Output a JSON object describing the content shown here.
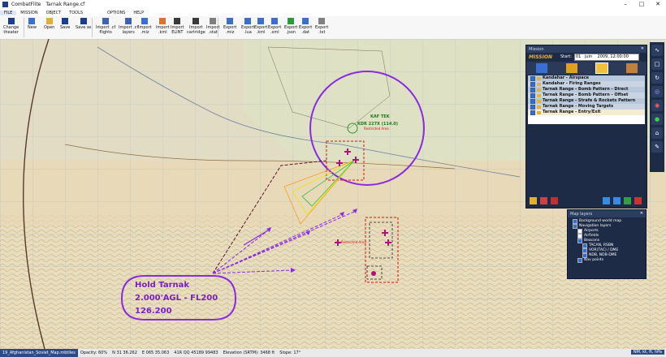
{
  "window": {
    "app": "CombatFlite",
    "doc": "Tarnak Range.cf"
  },
  "menu": [
    "FILE",
    "MISSION",
    "OBJECT",
    "TOOLS",
    "OPTIONS",
    "HELP"
  ],
  "ribbon": [
    {
      "label": "Change\ntheater",
      "icon": "globe-icon"
    },
    {
      "label": "New",
      "icon": "new-file-icon"
    },
    {
      "label": "Open",
      "icon": "folder-icon"
    },
    {
      "label": "Save",
      "icon": "save-icon"
    },
    {
      "label": "Save as",
      "icon": "save-as-icon"
    },
    {
      "label": "Import .cf\nflights",
      "icon": "import-flights-icon"
    },
    {
      "label": "Import .cf\nlayers",
      "icon": "import-layers-icon"
    },
    {
      "label": "Import\n.miz",
      "icon": "import-miz-icon"
    },
    {
      "label": "Import\n.kml",
      "icon": "import-kml-icon"
    },
    {
      "label": "Import\nELINT",
      "icon": "import-elint-icon"
    },
    {
      "label": "Import\ncartridge",
      "icon": "import-cartridge-icon"
    },
    {
      "label": "Import\n.stat",
      "icon": "import-stat-icon"
    },
    {
      "label": "Export\n.miz",
      "icon": "export-miz-icon"
    },
    {
      "label": "Export\n.lua",
      "icon": "export-lua-icon"
    },
    {
      "label": "Export\n.kml",
      "icon": "export-kml-icon"
    },
    {
      "label": "Export\n.xml",
      "icon": "export-xml-icon"
    },
    {
      "label": "Export\n.json",
      "icon": "export-json-icon"
    },
    {
      "label": "Export\n.dat",
      "icon": "export-dat-icon"
    },
    {
      "label": "Export\n.txt",
      "icon": "export-txt-icon"
    }
  ],
  "mission": {
    "title": "Mission",
    "label": "MISSION",
    "start_label": "Start:",
    "start_value": "01   juin    2009, 12:00:00",
    "items": [
      "Kandahar - Airspace",
      "Kandahar - Firing Ranges",
      "Tarnak Range - Bomb Pattern - Direct",
      "Tarnak Range - Bomb Pattern - Offset",
      "Tarnak Range - Strafe & Rockets Pattern",
      "Tarnak Range - Moving Targets",
      "Tarnak Range - Entry/Exit"
    ]
  },
  "layers": {
    "title": "Map layers",
    "items": [
      {
        "t": "Background world map",
        "lv": 0
      },
      {
        "t": "Navigation layers",
        "lv": 0
      },
      {
        "t": "Airports",
        "lv": 1
      },
      {
        "t": "Airfields",
        "lv": 1
      },
      {
        "t": "Beacons",
        "lv": 1
      },
      {
        "t": "TACAN, RSBN",
        "lv": 2
      },
      {
        "t": "VOR(TAC) / DME",
        "lv": 2
      },
      {
        "t": "NDB, NDB-DME",
        "lv": 2
      },
      {
        "t": "Nav points",
        "lv": 1
      }
    ]
  },
  "map": {
    "hold_lines": [
      "Hold Tarnak",
      "2.000'AGL - FL200",
      "126.200"
    ],
    "kaf_label": "KAF TEK",
    "kdr_label": "KDR 227X (114.0)",
    "lbl1": "Restricted Area",
    "lbl2": "Restricted Area"
  },
  "status": {
    "file": "19_Afghanistan_Soviet_Map.mbtiles",
    "opacity": "Opacity: 60%",
    "lat": "N 31 36.262",
    "lon": "E 065 35.063",
    "mgrs": "41R QQ 45189 99483",
    "elev": "Elevation (SRTM): 3468 ft",
    "slope": "Slope: 17°",
    "units": "NM, kt, ft, hPa"
  },
  "colors": {
    "accent": "#1d2b46",
    "purple": "#8a2be2",
    "red": "#d11",
    "magenta": "#b0107a"
  }
}
